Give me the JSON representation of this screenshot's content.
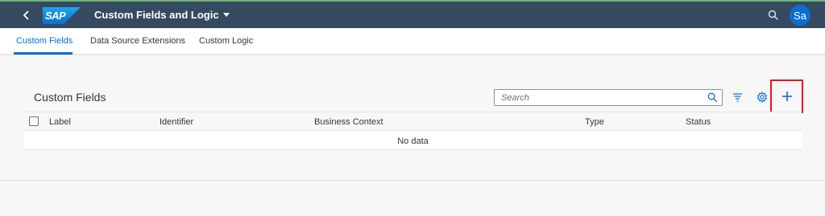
{
  "shell": {
    "logo_text": "SAP",
    "app_title": "Custom Fields and Logic",
    "avatar_initials": "Sa",
    "colors": {
      "shell_bg": "#354a5f",
      "logo_bg": "#0a6ed1",
      "accent": "#0a6ed1"
    }
  },
  "tabs": [
    {
      "label": "Custom Fields",
      "active": true
    },
    {
      "label": "Data Source Extensions",
      "active": false
    },
    {
      "label": "Custom Logic",
      "active": false
    }
  ],
  "panel": {
    "title": "Custom Fields",
    "search_placeholder": "Search",
    "search_value": ""
  },
  "table": {
    "columns": [
      "Label",
      "Identifier",
      "Business Context",
      "Type",
      "Status"
    ],
    "empty_text": "No data"
  },
  "icons": {
    "back": "chevron-left-icon",
    "search": "search-icon",
    "sort": "sort-icon",
    "settings": "gear-icon",
    "add": "plus-icon"
  }
}
